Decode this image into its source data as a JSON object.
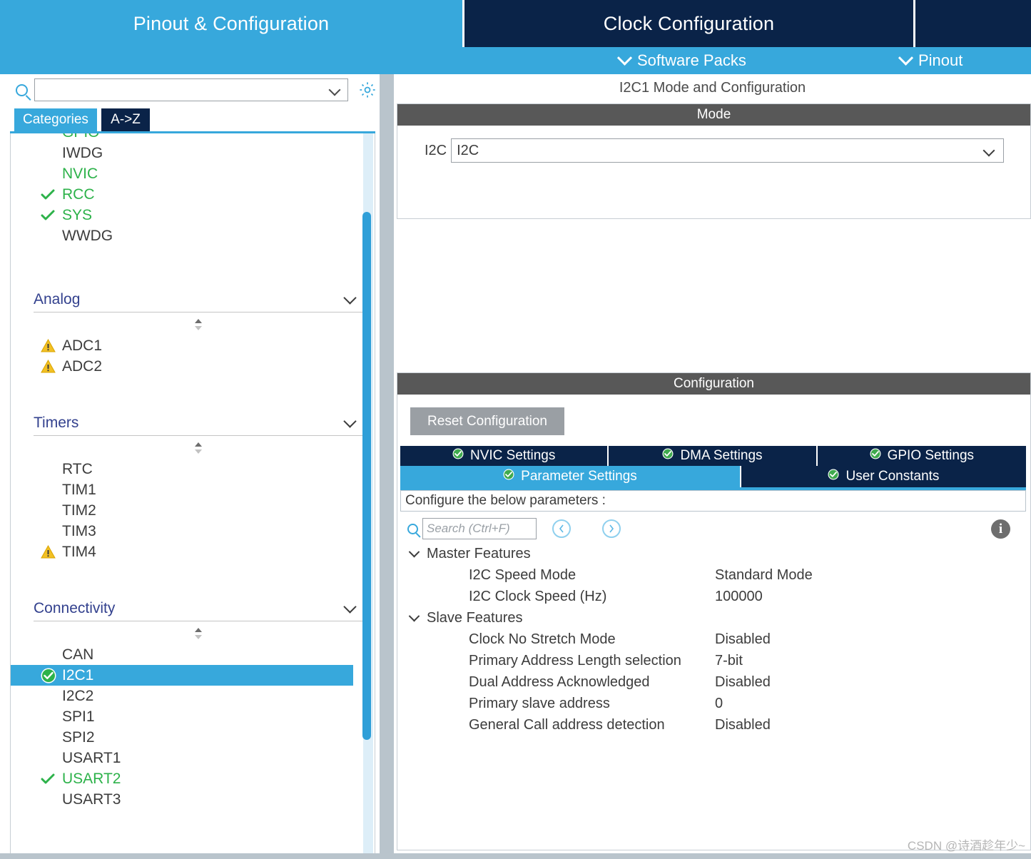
{
  "tabs": {
    "pinout_configuration": "Pinout & Configuration",
    "clock_configuration": "Clock Configuration"
  },
  "subbar": {
    "software_packs": "Software Packs",
    "pinout": "Pinout"
  },
  "left": {
    "search": {
      "value": "",
      "placeholder": ""
    },
    "category_tabs": {
      "categories": "Categories",
      "a_to_z": "A->Z"
    },
    "tree": [
      {
        "label": "GPIO",
        "state": "green",
        "clipped": true
      },
      {
        "label": "IWDG",
        "state": "normal"
      },
      {
        "label": "NVIC",
        "state": "green"
      },
      {
        "label": "RCC",
        "state": "check-green"
      },
      {
        "label": "SYS",
        "state": "check-green"
      },
      {
        "label": "WWDG",
        "state": "normal"
      }
    ],
    "groups": [
      {
        "title": "Analog",
        "items": [
          {
            "label": "ADC1",
            "state": "warning"
          },
          {
            "label": "ADC2",
            "state": "warning"
          }
        ]
      },
      {
        "title": "Timers",
        "items": [
          {
            "label": "RTC",
            "state": "normal"
          },
          {
            "label": "TIM1",
            "state": "normal"
          },
          {
            "label": "TIM2",
            "state": "normal"
          },
          {
            "label": "TIM3",
            "state": "normal"
          },
          {
            "label": "TIM4",
            "state": "warning"
          }
        ]
      },
      {
        "title": "Connectivity",
        "items": [
          {
            "label": "CAN",
            "state": "normal"
          },
          {
            "label": "I2C1",
            "state": "check-circle",
            "selected": true
          },
          {
            "label": "I2C2",
            "state": "normal"
          },
          {
            "label": "SPI1",
            "state": "normal"
          },
          {
            "label": "SPI2",
            "state": "normal"
          },
          {
            "label": "USART1",
            "state": "normal"
          },
          {
            "label": "USART2",
            "state": "check-green"
          },
          {
            "label": "USART3",
            "state": "normal"
          }
        ]
      }
    ]
  },
  "right": {
    "peripheral_title": "I2C1 Mode and Configuration",
    "mode": {
      "band_label": "Mode",
      "field_label": "I2C",
      "field_value": "I2C"
    },
    "configuration": {
      "band_label": "Configuration",
      "reset_button": "Reset Configuration",
      "tabs_row1": [
        {
          "label": "NVIC Settings",
          "active": false
        },
        {
          "label": "DMA Settings",
          "active": false
        },
        {
          "label": "GPIO Settings",
          "active": false
        }
      ],
      "tabs_row2": [
        {
          "label": "Parameter Settings",
          "active": true
        },
        {
          "label": "User Constants",
          "active": false
        }
      ],
      "hint": "Configure the below parameters :",
      "param_search": {
        "value": "",
        "placeholder": "Search (Ctrl+F)"
      },
      "param_groups": [
        {
          "title": "Master Features",
          "params": [
            {
              "name": "I2C Speed Mode",
              "value": "Standard Mode"
            },
            {
              "name": "I2C Clock Speed (Hz)",
              "value": "100000"
            }
          ]
        },
        {
          "title": "Slave Features",
          "params": [
            {
              "name": "Clock No Stretch Mode",
              "value": "Disabled"
            },
            {
              "name": "Primary Address Length selection",
              "value": "7-bit"
            },
            {
              "name": "Dual Address Acknowledged",
              "value": "Disabled"
            },
            {
              "name": "Primary slave address",
              "value": "0"
            },
            {
              "name": "General Call address detection",
              "value": "Disabled"
            }
          ]
        }
      ]
    }
  },
  "watermark": "CSDN @诗酒趁年少~",
  "colors": {
    "accent_blue": "#37a8dc",
    "dark_navy": "#0a2348",
    "band_gray": "#585858",
    "green": "#2db24a",
    "warning_yellow": "#f2c023",
    "gutter": "#b9c4cc"
  }
}
